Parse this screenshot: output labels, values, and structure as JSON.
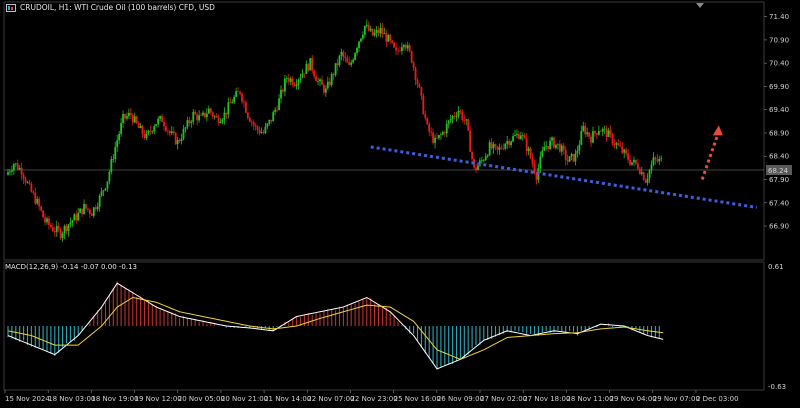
{
  "header": {
    "symbol_text": "CRUDOIL, H1:  WTI Crude Oil (100 barrels) CFD, USD",
    "icon": "chart-window-icon"
  },
  "price_axis": {
    "labels": [
      "71.40",
      "70.90",
      "70.40",
      "69.90",
      "69.40",
      "68.90",
      "68.40",
      "67.90",
      "67.40",
      "66.90"
    ],
    "current_price_tag": "68.24"
  },
  "macd": {
    "label": "MACD(12,26,9) -0.14 -0.07 0.00 -0.13",
    "axis_top": "0.61",
    "axis_bottom": "-0.63"
  },
  "time_axis": {
    "labels": [
      "15 Nov 2024",
      "18 Nov 03:00",
      "18 Nov 19:00",
      "19 Nov 12:00",
      "20 Nov 05:00",
      "20 Nov 21:00",
      "21 Nov 14:00",
      "22 Nov 07:00",
      "22 Nov 23:00",
      "25 Nov 16:00",
      "26 Nov 09:00",
      "27 Nov 02:00",
      "27 Nov 18:00",
      "28 Nov 11:00",
      "29 Nov 04:00",
      "29 Nov 07:00",
      "2 Dec 03:00"
    ]
  },
  "colors": {
    "background": "#000000",
    "bull": "#22c322",
    "bear": "#e81c1c",
    "trendline": "#3b5fe0",
    "arrow": "#e84a3c",
    "macd_line": "#ffffff",
    "signal_line": "#f0d23c",
    "hist_pos": "#c0302c",
    "hist_neg": "#2ba8b8"
  },
  "chart_data": {
    "type": "candlestick",
    "symbol": "CRUDOIL",
    "timeframe": "H1",
    "ylim": [
      66.6,
      71.5
    ],
    "current_price": 68.24,
    "close_path": [
      [
        0,
        68.0
      ],
      [
        1,
        68.25
      ],
      [
        2,
        68.1
      ],
      [
        3,
        67.7
      ],
      [
        4,
        67.4
      ],
      [
        5,
        67.0
      ],
      [
        6,
        66.85
      ],
      [
        7,
        66.75
      ],
      [
        8,
        66.95
      ],
      [
        9,
        67.1
      ],
      [
        10,
        67.3
      ],
      [
        11,
        67.2
      ],
      [
        12,
        67.5
      ],
      [
        13,
        67.9
      ],
      [
        14,
        68.6
      ],
      [
        15,
        69.2
      ],
      [
        16,
        69.3
      ],
      [
        17,
        69.0
      ],
      [
        18,
        68.8
      ],
      [
        19,
        69.1
      ],
      [
        20,
        69.2
      ],
      [
        21,
        68.9
      ],
      [
        22,
        68.7
      ],
      [
        23,
        69.0
      ],
      [
        24,
        69.3
      ],
      [
        25,
        69.2
      ],
      [
        26,
        69.4
      ],
      [
        27,
        69.2
      ],
      [
        28,
        69.3
      ],
      [
        29,
        69.6
      ],
      [
        30,
        69.8
      ],
      [
        31,
        69.3
      ],
      [
        32,
        69.0
      ],
      [
        33,
        68.9
      ],
      [
        34,
        69.2
      ],
      [
        35,
        69.6
      ],
      [
        36,
        70.1
      ],
      [
        37,
        70.0
      ],
      [
        38,
        70.2
      ],
      [
        39,
        70.4
      ],
      [
        40,
        70.0
      ],
      [
        41,
        69.8
      ],
      [
        42,
        70.2
      ],
      [
        43,
        70.6
      ],
      [
        44,
        70.3
      ],
      [
        45,
        70.8
      ],
      [
        46,
        71.2
      ],
      [
        47,
        71.0
      ],
      [
        48,
        71.1
      ],
      [
        49,
        70.9
      ],
      [
        50,
        70.6
      ],
      [
        51,
        70.9
      ],
      [
        52,
        70.5
      ],
      [
        53,
        69.8
      ],
      [
        54,
        69.0
      ],
      [
        55,
        68.7
      ],
      [
        56,
        68.9
      ],
      [
        57,
        69.2
      ],
      [
        58,
        69.4
      ],
      [
        59,
        69.1
      ],
      [
        60,
        68.1
      ],
      [
        61,
        68.3
      ],
      [
        62,
        68.6
      ],
      [
        63,
        68.5
      ],
      [
        64,
        68.7
      ],
      [
        65,
        68.8
      ],
      [
        66,
        68.9
      ],
      [
        67,
        68.5
      ],
      [
        68,
        68.0
      ],
      [
        69,
        68.6
      ],
      [
        70,
        68.7
      ],
      [
        71,
        68.6
      ],
      [
        72,
        68.3
      ],
      [
        73,
        68.4
      ],
      [
        74,
        69.0
      ],
      [
        75,
        68.8
      ],
      [
        76,
        69.0
      ],
      [
        77,
        68.9
      ],
      [
        78,
        68.7
      ],
      [
        79,
        68.5
      ],
      [
        80,
        68.3
      ],
      [
        81,
        68.2
      ],
      [
        82,
        67.9
      ],
      [
        83,
        68.3
      ]
    ],
    "trendline": [
      [
        46.5,
        68.6
      ],
      [
        96,
        67.3
      ]
    ],
    "arrow": {
      "from": [
        89,
        67.9
      ],
      "to": [
        91,
        69.0
      ]
    },
    "macd_ylim": [
      -0.63,
      0.61
    ],
    "macd_line": [
      [
        0,
        -0.1
      ],
      [
        3,
        -0.2
      ],
      [
        6,
        -0.3
      ],
      [
        9,
        -0.1
      ],
      [
        12,
        0.2
      ],
      [
        14,
        0.45
      ],
      [
        16,
        0.35
      ],
      [
        19,
        0.2
      ],
      [
        22,
        0.1
      ],
      [
        25,
        0.05
      ],
      [
        28,
        0.0
      ],
      [
        31,
        -0.02
      ],
      [
        34,
        -0.05
      ],
      [
        37,
        0.1
      ],
      [
        40,
        0.15
      ],
      [
        43,
        0.2
      ],
      [
        46,
        0.3
      ],
      [
        49,
        0.15
      ],
      [
        52,
        -0.1
      ],
      [
        55,
        -0.45
      ],
      [
        58,
        -0.35
      ],
      [
        61,
        -0.15
      ],
      [
        64,
        -0.05
      ],
      [
        67,
        -0.1
      ],
      [
        70,
        -0.05
      ],
      [
        73,
        -0.08
      ],
      [
        76,
        0.02
      ],
      [
        79,
        0.0
      ],
      [
        82,
        -0.1
      ],
      [
        84,
        -0.14
      ]
    ],
    "signal_line": [
      [
        0,
        -0.05
      ],
      [
        3,
        -0.1
      ],
      [
        6,
        -0.2
      ],
      [
        9,
        -0.2
      ],
      [
        12,
        0.0
      ],
      [
        14,
        0.2
      ],
      [
        16,
        0.3
      ],
      [
        19,
        0.25
      ],
      [
        22,
        0.15
      ],
      [
        25,
        0.1
      ],
      [
        28,
        0.05
      ],
      [
        31,
        0.0
      ],
      [
        34,
        -0.03
      ],
      [
        37,
        0.0
      ],
      [
        40,
        0.08
      ],
      [
        43,
        0.15
      ],
      [
        46,
        0.22
      ],
      [
        49,
        0.2
      ],
      [
        52,
        0.05
      ],
      [
        55,
        -0.25
      ],
      [
        58,
        -0.35
      ],
      [
        61,
        -0.25
      ],
      [
        64,
        -0.12
      ],
      [
        67,
        -0.1
      ],
      [
        70,
        -0.08
      ],
      [
        73,
        -0.07
      ],
      [
        76,
        -0.03
      ],
      [
        79,
        -0.01
      ],
      [
        82,
        -0.05
      ],
      [
        84,
        -0.07
      ]
    ]
  }
}
